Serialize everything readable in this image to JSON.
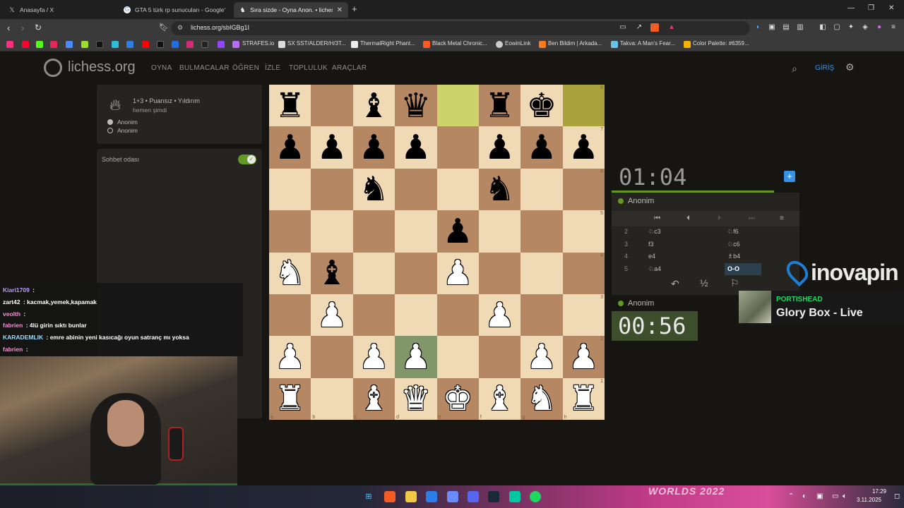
{
  "browser": {
    "tabs": [
      {
        "title": "Anasayfa / X",
        "icon": "x-logo-icon"
      },
      {
        "title": "GTA 5 türk rp sunucuları - Google'da",
        "icon": "google-icon"
      },
      {
        "title": "Sıra sizde - Oyna Anon. • lichess.",
        "icon": "lichess-icon",
        "active": true
      }
    ],
    "url": "lichess.org/sbIGBg1I",
    "bookmarks": [
      "STRAFES.io",
      "SX SST/ALDER/H/3T...",
      "ThermalRight Phant...",
      "Black Metal Chronic...",
      "EowinLink",
      "Ben Bildim | Arkada...",
      "Takva: A Man's Fear...",
      "Color Palette: #6359..."
    ]
  },
  "lichess": {
    "logo": "lichess.org",
    "nav": [
      "OYNA",
      "BULMACALAR",
      "ÖĞREN",
      "İZLE",
      "TOPLULUK",
      "ARAÇLAR"
    ],
    "login": "GİRİŞ"
  },
  "game_info": {
    "type": "1+3 • Puansız • Yıldırım",
    "time": "hemen şimdi",
    "players": [
      "Anonim",
      "Anonim"
    ],
    "chat_label": "Sohbet odası"
  },
  "board": {
    "files": [
      "a",
      "b",
      "c",
      "d",
      "e",
      "f",
      "g",
      "h"
    ],
    "ranks": [
      "8",
      "7",
      "6",
      "5",
      "4",
      "3",
      "2",
      "1"
    ],
    "rows": [
      [
        "bR",
        "",
        "bB",
        "bQ",
        "",
        "bR",
        "bK",
        ""
      ],
      [
        "bP",
        "bP",
        "bP",
        "bP",
        "",
        "bP",
        "bP",
        "bP"
      ],
      [
        "",
        "",
        "bN",
        "",
        "",
        "bN",
        "",
        ""
      ],
      [
        "",
        "",
        "",
        "",
        "bP",
        "",
        "",
        ""
      ],
      [
        "wN",
        "bB",
        "",
        "",
        "wP",
        "",
        "",
        ""
      ],
      [
        "",
        "wP",
        "",
        "",
        "",
        "wP",
        "",
        ""
      ],
      [
        "wP",
        "",
        "wP",
        "wP",
        "",
        "",
        "wP",
        "wP"
      ],
      [
        "wR",
        "",
        "wB",
        "wQ",
        "wK",
        "wB",
        "wN",
        "wR"
      ]
    ],
    "highlight": [
      "e8",
      "h8"
    ],
    "selected": "d2"
  },
  "clocks": {
    "top": "01:04",
    "bottom": "00:56",
    "top_player": "Anonim",
    "bottom_player": "Anonim"
  },
  "moves": [
    {
      "num": "2",
      "white": "♘c3",
      "black": "♘f6"
    },
    {
      "num": "3",
      "white": "f3",
      "black": "♘c6"
    },
    {
      "num": "4",
      "white": "e4",
      "black": "♗b4"
    },
    {
      "num": "5",
      "white": "♘a4",
      "black": "O-O",
      "current": true
    }
  ],
  "draw_label": "½",
  "stream": {
    "chat": [
      {
        "user": "Kiari1709",
        "text": "",
        "color": "#b7a0ff"
      },
      {
        "user": "zart42",
        "text": "kacmak,yemek,kapamak",
        "color": "#ffffff"
      },
      {
        "user": "veolth",
        "text": "",
        "color": "#ff8ad6"
      },
      {
        "user": "fabrien",
        "text": "4lü girin sıktı bunlar",
        "color": "#ff8ad6"
      },
      {
        "user": "KARADEMLIK",
        "text": "emre abinin yeni kasıcağı oyun satranç mı yoksa",
        "color": "#9adcff"
      },
      {
        "user": "fabrien",
        "text": "",
        "color": "#ff8ad6"
      }
    ],
    "sponsor": "inovapin",
    "now_playing_artist": "PORTISHEAD",
    "now_playing_title": "Glory Box - Live",
    "taskbar_banner": "WORLDS 2022",
    "time": "17:29",
    "date": "3.11.2025"
  }
}
